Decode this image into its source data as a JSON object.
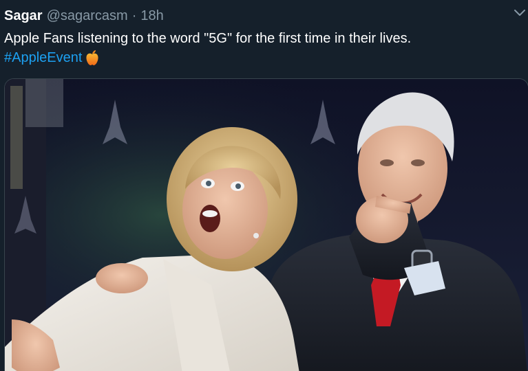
{
  "tweet": {
    "display_name": "Sagar",
    "handle": "@sagarcasm",
    "separator": "·",
    "time_ago": "18h",
    "text": "Apple Fans listening to the word \"5G\" for the first time in their lives.",
    "hashtag": "#AppleEvent",
    "emoji": "apple-emoji-icon"
  },
  "colors": {
    "background": "#15202b",
    "text": "#ffffff",
    "muted": "#8899a6",
    "link": "#1da1f2"
  }
}
